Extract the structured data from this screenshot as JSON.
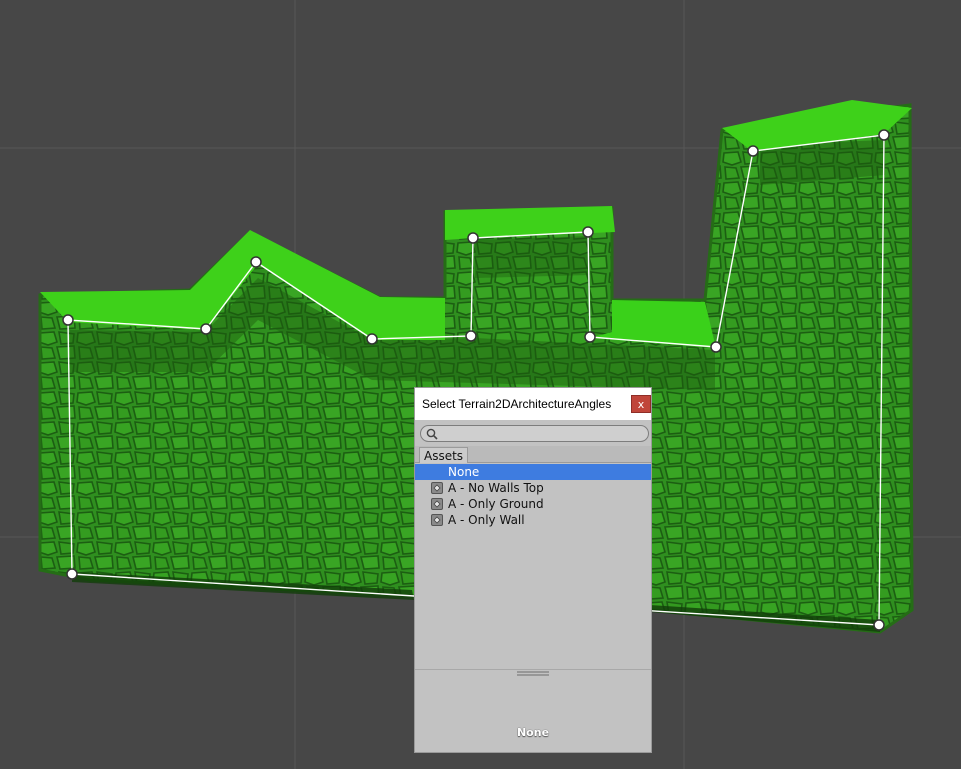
{
  "picker": {
    "title": "Select Terrain2DArchitectureAngles",
    "close_label": "x",
    "search": {
      "value": "",
      "placeholder": ""
    },
    "tabs": [
      {
        "label": "Assets"
      }
    ],
    "items": [
      {
        "label": "None",
        "selected": true,
        "icon": ""
      },
      {
        "label": "A - No Walls Top",
        "selected": false,
        "icon": "unity-asset-icon"
      },
      {
        "label": "A - Only Ground",
        "selected": false,
        "icon": "unity-asset-icon"
      },
      {
        "label": "A - Only Wall",
        "selected": false,
        "icon": "unity-asset-icon"
      }
    ],
    "preview_label": "None"
  },
  "colors": {
    "scene_background": "#474747",
    "terrain_wall": "#2e8f1c",
    "terrain_top": "#3ad11a",
    "selection": "#3e7ce0",
    "close_button": "#c0453a"
  }
}
